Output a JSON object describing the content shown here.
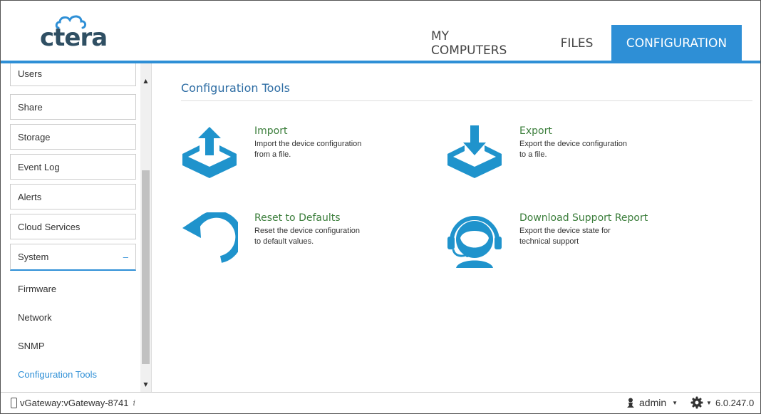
{
  "app": {
    "logo_text": "ctera"
  },
  "nav": {
    "tabs": [
      {
        "label": "MY COMPUTERS",
        "active": false
      },
      {
        "label": "FILES",
        "active": false
      },
      {
        "label": "CONFIGURATION",
        "active": true
      }
    ]
  },
  "sidebar": {
    "items": [
      {
        "label": "Users"
      },
      {
        "label": "Share"
      },
      {
        "label": "Storage"
      },
      {
        "label": "Event Log"
      },
      {
        "label": "Alerts"
      },
      {
        "label": "Cloud Services"
      },
      {
        "label": "System",
        "expanded": true,
        "toggle": "–"
      }
    ],
    "sub_items": [
      {
        "label": "Firmware",
        "active": false
      },
      {
        "label": "Network",
        "active": false
      },
      {
        "label": "SNMP",
        "active": false
      },
      {
        "label": "Configuration Tools",
        "active": true
      }
    ]
  },
  "main": {
    "title": "Configuration Tools",
    "tools": [
      {
        "label": "Import",
        "description": "Import the device configuration from a file.",
        "icon": "import-icon"
      },
      {
        "label": "Export",
        "description": "Export the device configuration to a file.",
        "icon": "export-icon"
      },
      {
        "label": "Reset to Defaults",
        "description": "Reset the device configuration to default values.",
        "icon": "reset-icon"
      },
      {
        "label": "Download Support Report",
        "description": "Export the device state for technical support",
        "icon": "support-headset-icon"
      }
    ]
  },
  "footer": {
    "device": "vGateway:vGateway-8741",
    "user": "admin",
    "version": "6.0.247.0"
  },
  "colors": {
    "accent": "#2e8fd6",
    "icon_blue": "#1f93cc",
    "tool_label_green": "#3a7d3a",
    "title_blue": "#2e6da4"
  }
}
